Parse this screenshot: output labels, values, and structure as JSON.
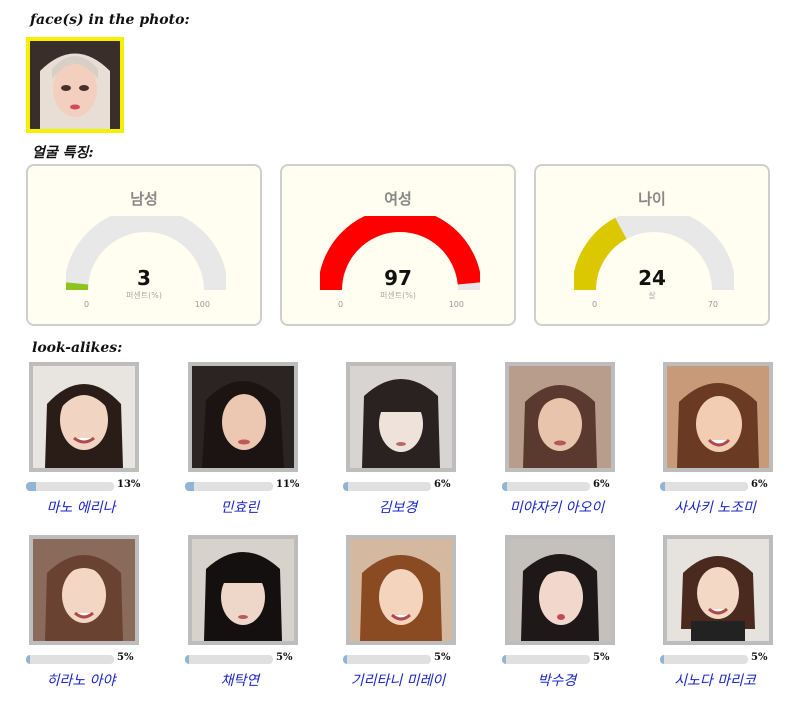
{
  "headings": {
    "faces": "face(s) in the photo:",
    "features": "얼굴 특징:",
    "lookalikes": "look-alikes:"
  },
  "gauges": [
    {
      "title": "남성",
      "value": "3",
      "unit": "퍼센트(%)",
      "min": "0",
      "max": "100",
      "fraction": 0.03,
      "color": "#8dc21f"
    },
    {
      "title": "여성",
      "value": "97",
      "unit": "퍼센트(%)",
      "min": "0",
      "max": "100",
      "fraction": 0.97,
      "color": "#ff0000"
    },
    {
      "title": "나이",
      "value": "24",
      "unit": "살",
      "min": "0",
      "max": "70",
      "fraction": 0.343,
      "color": "#dcc800"
    }
  ],
  "lookalikes": [
    {
      "name": "마노 에리나",
      "percent": "13%",
      "value": 13
    },
    {
      "name": "민효린",
      "percent": "11%",
      "value": 11
    },
    {
      "name": "김보경",
      "percent": "6%",
      "value": 6
    },
    {
      "name": "미야자키 아오이",
      "percent": "6%",
      "value": 6
    },
    {
      "name": "사사키 노조미",
      "percent": "6%",
      "value": 6
    },
    {
      "name": "히라노 아야",
      "percent": "5%",
      "value": 5
    },
    {
      "name": "채탁연",
      "percent": "5%",
      "value": 5
    },
    {
      "name": "기리타니 미레이",
      "percent": "5%",
      "value": 5
    },
    {
      "name": "박수경",
      "percent": "5%",
      "value": 5
    },
    {
      "name": "시노다 마리코",
      "percent": "5%",
      "value": 5
    }
  ],
  "colors": {
    "face_border": "#f5ef00",
    "photo_border": "#bdbdbd",
    "bar_fill": "#8fb4d4",
    "name_link": "#1a24c8"
  }
}
